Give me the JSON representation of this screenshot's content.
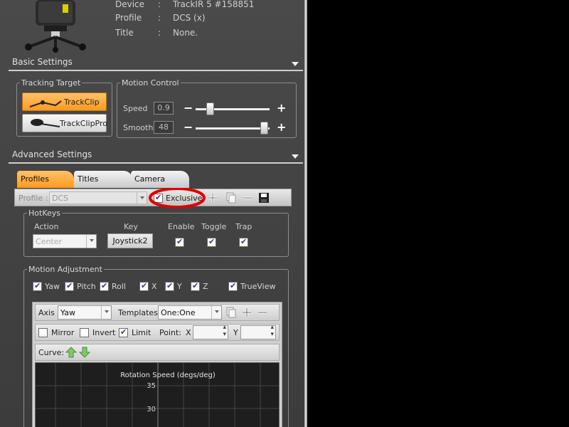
{
  "device_info": [
    {
      "key": "Device",
      "sep": ":",
      "value": "TrackIR 5 #158851"
    },
    {
      "key": "Profile",
      "sep": ":",
      "value": "DCS (x)"
    },
    {
      "key": "Title",
      "sep": ":",
      "value": "None."
    }
  ],
  "basic_settings": {
    "title": "Basic Settings",
    "tracking_target": {
      "legend": "Tracking Target",
      "options": [
        "TrackClip",
        "TrackClipPro"
      ],
      "selected": "TrackClip"
    },
    "motion_control": {
      "legend": "Motion Control",
      "speed_label": "Speed",
      "speed_value": "0.9",
      "smooth_label": "Smooth",
      "smooth_value": "48",
      "minus": "−",
      "plus": "+"
    }
  },
  "advanced_settings": {
    "title": "Advanced Settings",
    "tabs": [
      "Profiles",
      "Titles",
      "Camera"
    ],
    "active_tab": "Profiles",
    "profile_bar": {
      "label": "Profile :",
      "value": "DCS",
      "exclusive_label": "Exclusive",
      "exclusive_checked": true
    },
    "hotkeys": {
      "legend": "HotKeys",
      "headers": [
        "Action",
        "Key",
        "Enable",
        "Toggle",
        "Trap"
      ],
      "action_value": "Center",
      "key_value": "Joystick2",
      "enable": true,
      "toggle": true,
      "trap": true
    },
    "motion_adjustment": {
      "legend": "Motion Adjustment",
      "axes": [
        {
          "label": "Yaw",
          "checked": true
        },
        {
          "label": "Pitch",
          "checked": true
        },
        {
          "label": "Roll",
          "checked": true
        },
        {
          "label": "X",
          "checked": true
        },
        {
          "label": "Y",
          "checked": true
        },
        {
          "label": "Z",
          "checked": true
        },
        {
          "label": "TrueView",
          "checked": true
        }
      ],
      "axis_label": "Axis",
      "axis_value": "Yaw",
      "templates_label": "Templates",
      "templates_value": "One:One",
      "mirror_label": "Mirror",
      "invert_label": "Invert",
      "limit_label": "Limit",
      "mirror": false,
      "invert": false,
      "limit": true,
      "point_label": "Point:",
      "x_label": "X",
      "y_label": "Y",
      "curve_label": "Curve:"
    },
    "graph": {
      "title": "Rotation Speed (degs/deg)",
      "ticks": [
        "35",
        "30"
      ]
    }
  },
  "colors": {
    "accent_orange": "#ff9a1f",
    "highlight_red": "#e00000",
    "panel_bg": "#454545"
  }
}
